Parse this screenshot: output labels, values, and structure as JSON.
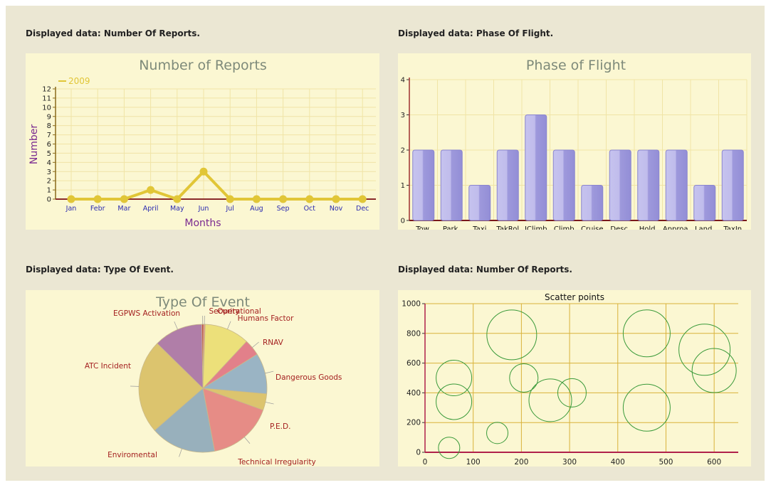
{
  "panels": [
    {
      "heading": "Displayed data: Number Of Reports."
    },
    {
      "heading": "Displayed data: Phase Of Flight."
    },
    {
      "heading": "Displayed data: Type Of Event."
    },
    {
      "heading": "Displayed data: Number Of Reports."
    }
  ],
  "colors": {
    "background": "#ebe7d3",
    "panel": "#fbf7d2",
    "line_series": "#e1c637",
    "bar_fill": "#9e99dc",
    "scatter_stroke": "#3a9a3a",
    "label_red": "#a42020",
    "axis_purple": "#7a2a90"
  },
  "chart_data": [
    {
      "type": "line",
      "title": "Number of Reports",
      "xlabel": "Months",
      "ylabel": "Number",
      "categories": [
        "Jan",
        "Febr",
        "Mar",
        "April",
        "May",
        "Jun",
        "Jul",
        "Aug",
        "Sep",
        "Oct",
        "Nov",
        "Dec"
      ],
      "series": [
        {
          "name": "2009",
          "values": [
            0,
            0,
            0,
            1,
            0,
            3,
            0,
            0,
            0,
            0,
            0,
            0
          ]
        }
      ],
      "ylim": [
        0,
        12
      ],
      "yticks": [
        "0",
        "1",
        "2",
        "3",
        "4",
        "5",
        "6",
        "7",
        "8",
        "9",
        "10",
        "11",
        "12"
      ],
      "grid": true,
      "legend": "top-left"
    },
    {
      "type": "bar",
      "title": "Phase of Flight",
      "categories": [
        "Tow.",
        "Park.",
        "Taxi",
        "TakRol",
        "IClimb",
        "Climb",
        "Cruise",
        "Desc.",
        "Hold.",
        "Approa.",
        "Land.",
        "TaxIn"
      ],
      "values": [
        2,
        2,
        1,
        2,
        3,
        2,
        1,
        2,
        2,
        2,
        1,
        2
      ],
      "ylim": [
        0,
        4
      ],
      "yticks": [
        "0",
        "1",
        "2",
        "3",
        "4"
      ],
      "grid": true
    },
    {
      "type": "pie",
      "title": "Type Of Event",
      "slices": [
        {
          "label": "Operational",
          "value": 0.4,
          "color": "#e59088"
        },
        {
          "label": "Humans Factor",
          "value": 11,
          "color": "#ece07a"
        },
        {
          "label": "RNAV",
          "value": 4,
          "color": "#e2808a"
        },
        {
          "label": "Dangerous Goods",
          "value": 10,
          "color": "#9ab4c4"
        },
        {
          "label": "P.E.D.",
          "value": 4,
          "color": "#dcc46e"
        },
        {
          "label": "Technical Irregularity",
          "value": 16,
          "color": "#e68c86"
        },
        {
          "label": "Enviromental",
          "value": 16,
          "color": "#98b0bc"
        },
        {
          "label": "ATC Incident",
          "value": 23,
          "color": "#dcc46e"
        },
        {
          "label": "EGPWS Activation",
          "value": 12,
          "color": "#b07ea8"
        },
        {
          "label": "Security",
          "value": 0.4,
          "color": "#c04848"
        }
      ]
    },
    {
      "type": "scatter",
      "title": "Scatter points",
      "xlim": [
        0,
        650
      ],
      "ylim": [
        0,
        1000
      ],
      "xticks": [
        "0",
        "100",
        "200",
        "300",
        "400",
        "500",
        "600"
      ],
      "yticks": [
        "0",
        "200",
        "400",
        "600",
        "800",
        "1000"
      ],
      "grid": true,
      "points": [
        {
          "x": 50,
          "y": 30,
          "size": 15
        },
        {
          "x": 150,
          "y": 130,
          "size": 15
        },
        {
          "x": 60,
          "y": 500,
          "size": 25
        },
        {
          "x": 60,
          "y": 340,
          "size": 25
        },
        {
          "x": 180,
          "y": 790,
          "size": 35
        },
        {
          "x": 205,
          "y": 500,
          "size": 20
        },
        {
          "x": 260,
          "y": 350,
          "size": 30
        },
        {
          "x": 305,
          "y": 400,
          "size": 20
        },
        {
          "x": 460,
          "y": 800,
          "size": 33
        },
        {
          "x": 460,
          "y": 300,
          "size": 33
        },
        {
          "x": 580,
          "y": 690,
          "size": 36
        },
        {
          "x": 600,
          "y": 550,
          "size": 31
        }
      ]
    }
  ]
}
